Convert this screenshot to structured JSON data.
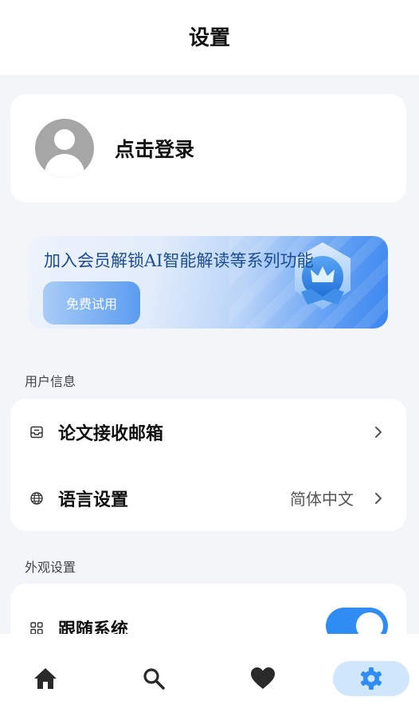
{
  "header": {
    "title": "设置"
  },
  "login": {
    "text": "点击登录"
  },
  "banner": {
    "text": "加入会员解锁AI智能解读等系列功能",
    "button_label": "免费试用"
  },
  "sections": {
    "user_info": {
      "label": "用户信息",
      "items": [
        {
          "label": "论文接收邮箱",
          "icon": "inbox-icon"
        },
        {
          "label": "语言设置",
          "value": "简体中文",
          "icon": "globe-icon"
        }
      ]
    },
    "appearance": {
      "label": "外观设置",
      "items": [
        {
          "label": "跟随系统",
          "icon": "grid-icon",
          "toggle_on": true
        }
      ]
    }
  },
  "bottom_nav": {
    "items": [
      {
        "name": "home",
        "icon": "home-icon"
      },
      {
        "name": "search",
        "icon": "search-icon"
      },
      {
        "name": "favorites",
        "icon": "heart-icon"
      },
      {
        "name": "settings",
        "icon": "gear-icon",
        "active": true
      }
    ]
  },
  "colors": {
    "accent": "#2f8cf2",
    "nav_active_bg": "#cfe6fd",
    "page_bg": "#f3f5f9"
  }
}
